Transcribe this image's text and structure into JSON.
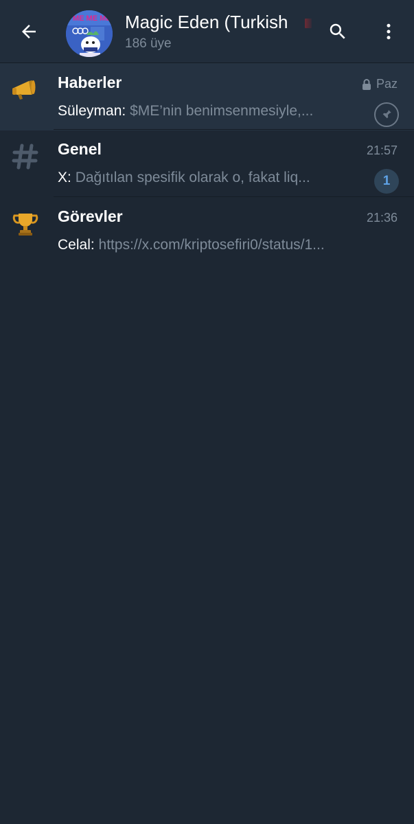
{
  "header": {
    "title": "Magic Eden (Turkish",
    "subtitle": "186 üye"
  },
  "topics": [
    {
      "name": "Haberler",
      "icon": "megaphone-icon",
      "time": "Paz",
      "locked": true,
      "sender": "Süleyman:",
      "message": "$ME’nin benimsenmesiyle,...",
      "pinned": true
    },
    {
      "name": "Genel",
      "icon": "hashtag-icon",
      "time": "21:57",
      "sender": "X:",
      "message": "Dağıtılan spesifik olarak o, fakat liq...",
      "unread": "1"
    },
    {
      "name": "Görevler",
      "icon": "trophy-icon",
      "time": "21:36",
      "sender": "Celal:",
      "message": "https://x.com/kriptosefiri0/status/1..."
    }
  ],
  "colors": {
    "background": "#1d2733",
    "header": "#212d3b",
    "pinned_row": "#253241",
    "secondary_text": "#7e8b99",
    "badge_text": "#5fa3e6"
  }
}
